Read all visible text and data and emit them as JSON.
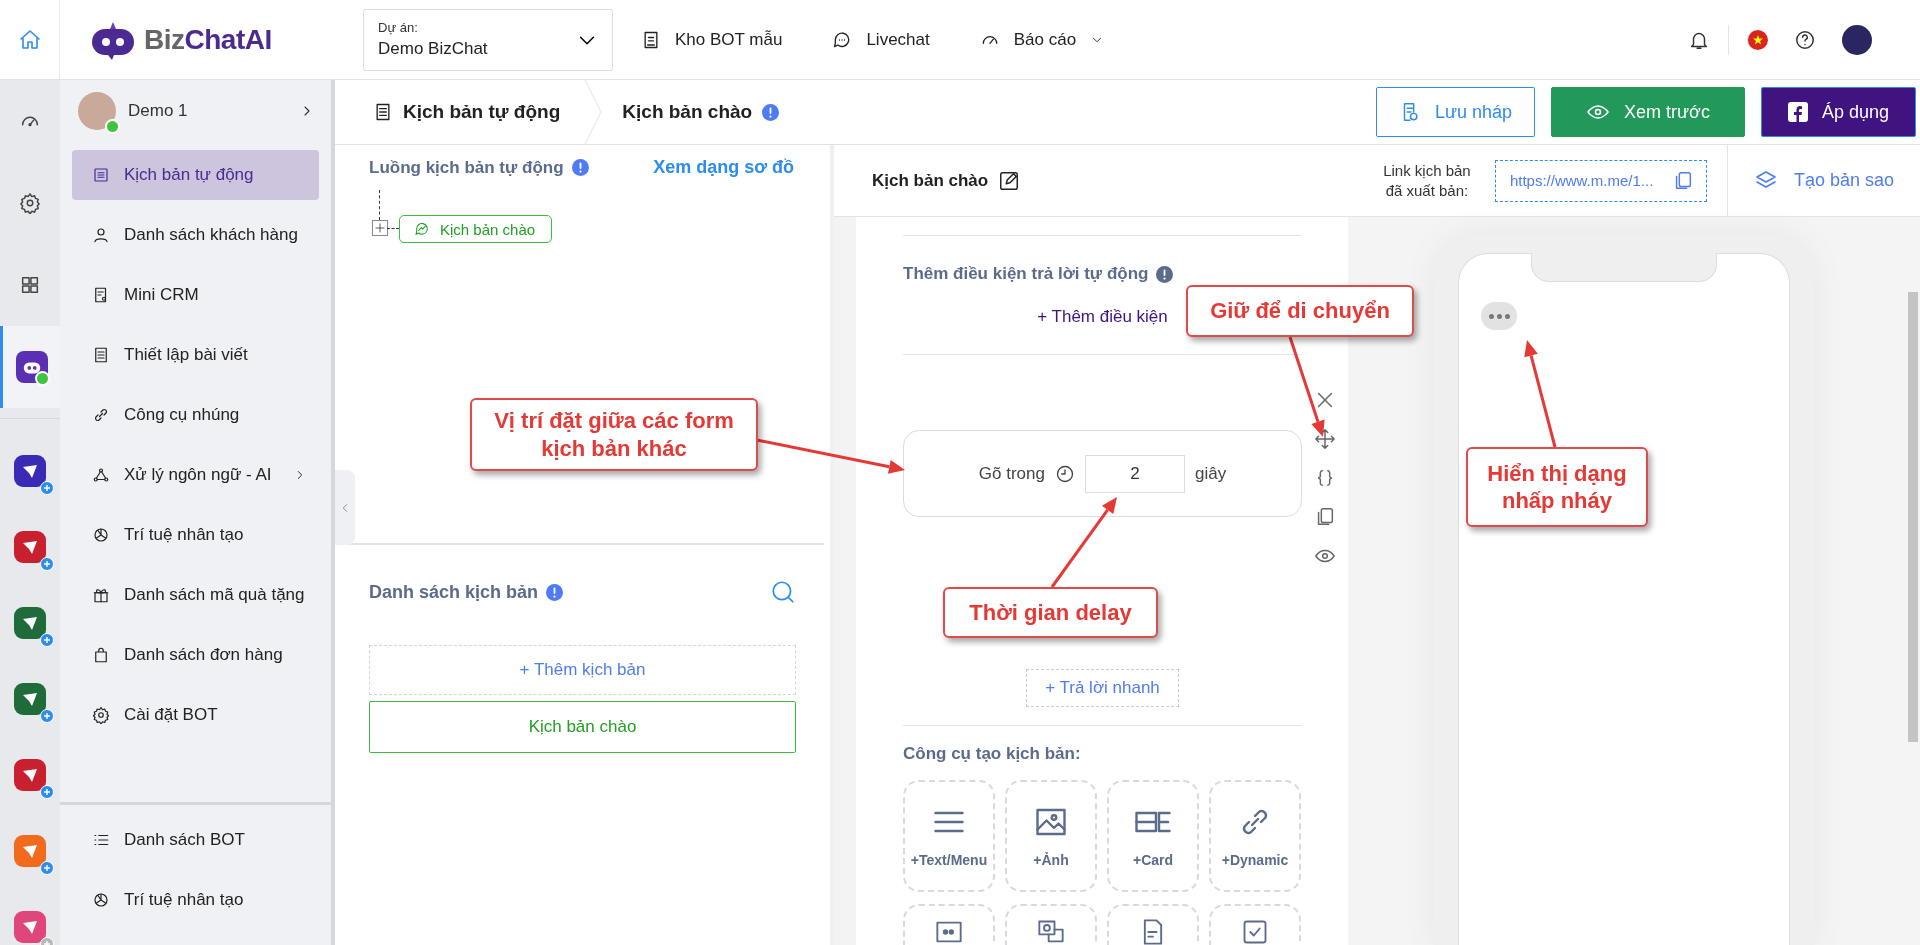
{
  "topbar": {
    "brand": {
      "prefix": "Biz",
      "name": "ChatAI"
    },
    "project_label": "Dự án:",
    "project_value": "Demo BizChat",
    "nav": [
      {
        "label": "Kho BOT mẫu",
        "has_dropdown": false
      },
      {
        "label": "Livechat",
        "has_dropdown": false
      },
      {
        "label": "Báo cáo",
        "has_dropdown": true
      }
    ]
  },
  "rail": {
    "items": [
      {
        "selected": false
      },
      {
        "selected": false
      },
      {
        "selected": false
      },
      {
        "selected": true,
        "online": true
      }
    ],
    "apps": [
      {
        "color": "#3a2bb5",
        "enabled": true
      },
      {
        "color": "#c8202f",
        "enabled": true
      },
      {
        "color": "#1f6b3a",
        "enabled": true
      },
      {
        "color": "#1f6b3a",
        "enabled": true
      },
      {
        "color": "#c8202f",
        "enabled": true
      },
      {
        "color": "#f26b1d",
        "enabled": true
      },
      {
        "color": "#e0457b",
        "enabled": false
      }
    ]
  },
  "sidebar": {
    "profile": {
      "name": "Demo 1",
      "online": true
    },
    "items": [
      {
        "label": "Kịch bản tự động",
        "selected": true,
        "has_submenu": false
      },
      {
        "label": "Danh sách khách hàng",
        "selected": false,
        "has_submenu": false
      },
      {
        "label": "Mini CRM",
        "selected": false,
        "has_submenu": false
      },
      {
        "label": "Thiết lập bài viết",
        "selected": false,
        "has_submenu": false
      },
      {
        "label": "Công cụ nhúng",
        "selected": false,
        "has_submenu": false
      },
      {
        "label": "Xử lý ngôn ngữ - AI",
        "selected": false,
        "has_submenu": true
      },
      {
        "label": "Trí tuệ nhân tạo",
        "selected": false,
        "has_submenu": false
      },
      {
        "label": "Danh sách mã quà tặng",
        "selected": false,
        "has_submenu": false
      },
      {
        "label": "Danh sách đơn hàng",
        "selected": false,
        "has_submenu": false
      },
      {
        "label": "Cài đặt BOT",
        "selected": false,
        "has_submenu": false
      }
    ],
    "bottom_items": [
      {
        "label": "Danh sách BOT",
        "selected": false
      },
      {
        "label": "Trí tuệ nhân tạo",
        "selected": false
      }
    ]
  },
  "header": {
    "breadcrumb": [
      "Kịch bản tự động",
      "Kịch bản chào"
    ],
    "buttons": [
      {
        "label": "Lưu nháp",
        "kind": "outline"
      },
      {
        "label": "Xem trước",
        "kind": "success"
      },
      {
        "label": "Áp dụng",
        "kind": "primary"
      }
    ]
  },
  "flow_panel": {
    "title": "Luồng kịch bản tự động",
    "view_link": "Xem dạng sơ đồ",
    "nodes": [
      {
        "label": "Kịch bản chào"
      }
    ]
  },
  "list_panel": {
    "title": "Danh sách kịch bản",
    "add_label": "+ Thêm kịch bản",
    "scripts": [
      {
        "label": "Kịch bản chào",
        "selected": true
      }
    ]
  },
  "editor": {
    "title": "Kịch bản chào",
    "link_label": "Link kịch bản đã xuất bản:",
    "link_value": "https://www.m.me/1...",
    "copy_label": "Tạo bản sao",
    "condition_title": "Thêm điều kiện trả lời tự động",
    "add_condition": "+ Thêm điều kiện",
    "delay": {
      "prefix": "Gõ trong",
      "value": "2",
      "unit": "giây"
    },
    "quick_reply": "+ Trả lời nhanh",
    "tools_title": "Công cụ tạo kịch bản:",
    "tools": [
      {
        "label": "+Text/Menu"
      },
      {
        "label": "+Ảnh"
      },
      {
        "label": "+Card"
      },
      {
        "label": "+Dynamic"
      }
    ]
  },
  "preview": {
    "typing": true
  },
  "annotations": [
    {
      "text": "Vị trí đặt giữa các form kịch bản khác"
    },
    {
      "text": "Giữ để di chuyển"
    },
    {
      "text": "Thời gian delay"
    },
    {
      "text": "Hiển thị dạng nhấp nháy"
    }
  ]
}
